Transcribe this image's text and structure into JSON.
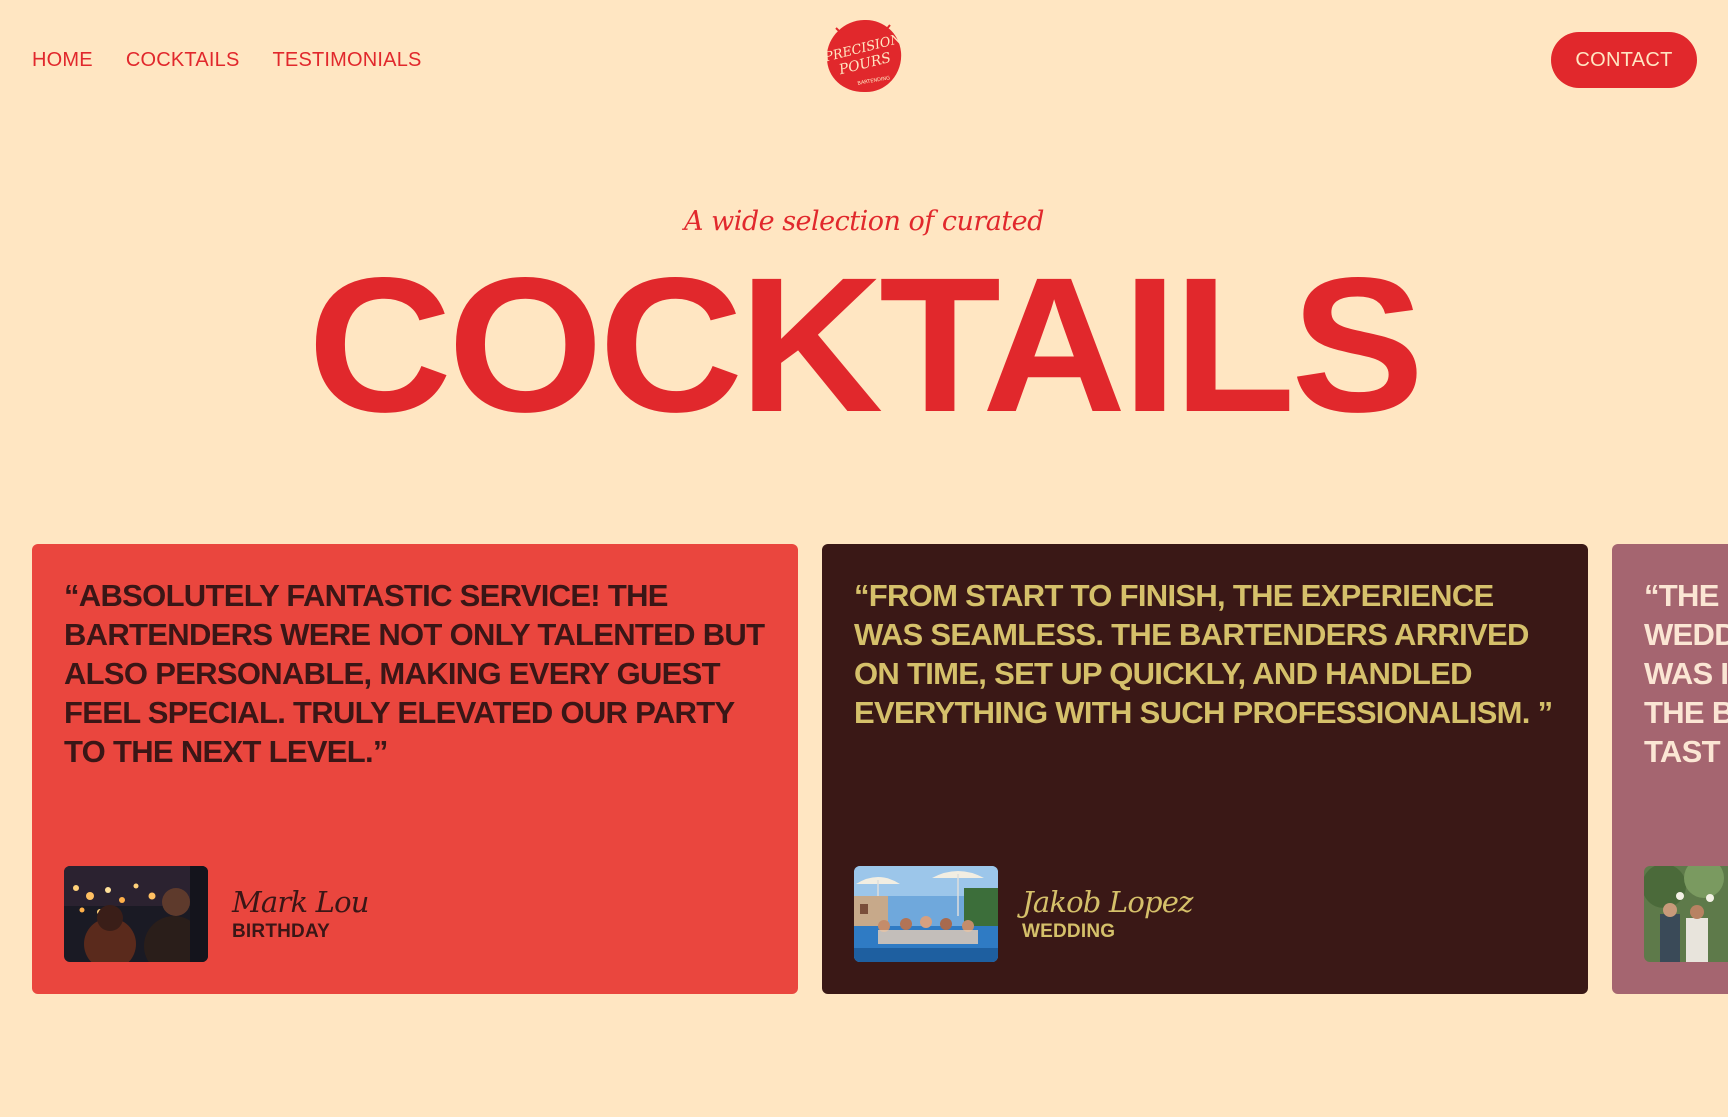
{
  "nav": {
    "links": [
      {
        "label": "HOME"
      },
      {
        "label": "COCKTAILS"
      },
      {
        "label": "TESTIMONIALS"
      }
    ],
    "logo": {
      "line1": "PRECISION",
      "line2": "POURS",
      "tagline": "BARTENDING"
    },
    "contact_label": "CONTACT"
  },
  "hero": {
    "subtitle": "A wide selection of curated",
    "title": "COCKTAILS"
  },
  "testimonials": [
    {
      "quote": "“ABSOLUTELY FANTASTIC SERVICE! THE BARTENDERS WERE NOT ONLY TALENTED BUT ALSO PERSONABLE, MAKING EVERY GUEST FEEL SPECIAL. TRULY ELEVATED OUR PARTY TO THE NEXT LEVEL.”",
      "name": "Mark Lou",
      "event": "BIRTHDAY",
      "bg": "#EA463E",
      "fg": "#3A1616"
    },
    {
      "quote": "“FROM START TO FINISH, THE EXPERIENCE WAS SEAMLESS. THE BARTENDERS ARRIVED ON TIME, SET UP QUICKLY, AND HANDLED EVERYTHING WITH SUCH PROFESSIONALISM. ”",
      "name": "Jakob Lopez",
      "event": "WEDDING",
      "bg": "#3A1816",
      "fg": "#D5C06A"
    },
    {
      "quote": "“THE WEDD WAS I THE B TAST",
      "bg": "#A56570",
      "fg": "#FBE6D4"
    }
  ],
  "colors": {
    "background": "#FFE6C2",
    "accent": "#E1282C"
  }
}
